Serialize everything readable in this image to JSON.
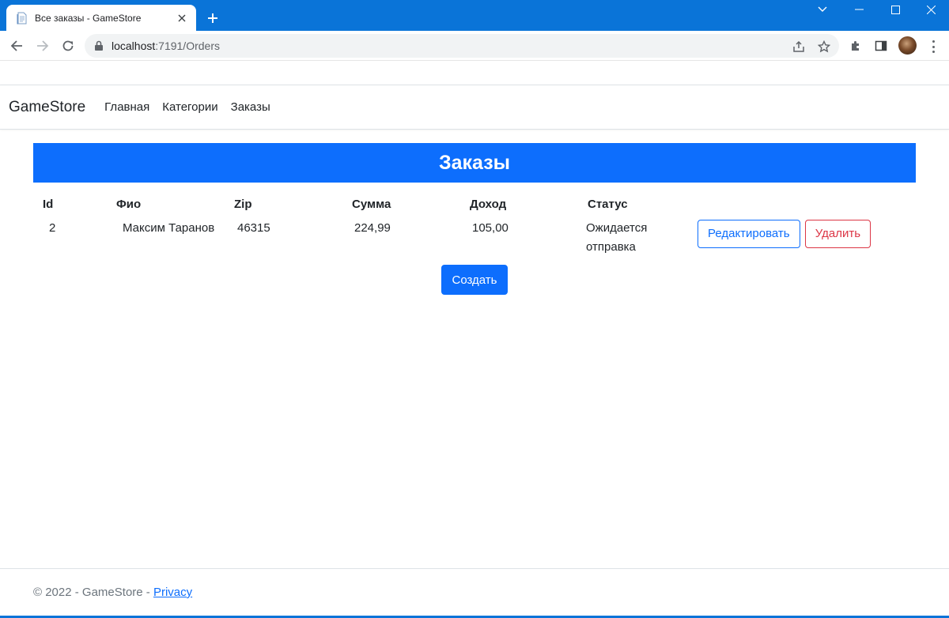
{
  "browser": {
    "tab_title": "Все заказы - GameStore",
    "url_host": "localhost",
    "url_path": ":7191/Orders",
    "accent_color": "#0a74d8"
  },
  "nav": {
    "brand": "GameStore",
    "links": [
      "Главная",
      "Категории",
      "Заказы"
    ]
  },
  "page": {
    "title": "Заказы",
    "header_color": "#0d6efd"
  },
  "table": {
    "columns": [
      "Id",
      "Фио",
      "Zip",
      "Сумма",
      "Доход",
      "Статус"
    ],
    "rows": [
      {
        "id": "2",
        "fio": "Максим Таранов",
        "zip": "46315",
        "sum": "224,99",
        "income": "105,00",
        "status": "Ожидается отправка",
        "edit_label": "Редактировать",
        "delete_label": "Удалить"
      }
    ]
  },
  "actions": {
    "create_label": "Создать"
  },
  "footer": {
    "text": "© 2022 - GameStore - ",
    "privacy_link": "Privacy"
  }
}
